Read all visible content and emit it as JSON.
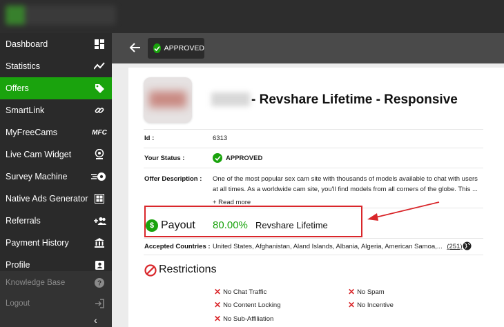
{
  "sidebar": {
    "items": [
      {
        "label": "Dashboard",
        "icon": "dashboard-icon"
      },
      {
        "label": "Statistics",
        "icon": "trend-icon"
      },
      {
        "label": "Offers",
        "icon": "tag-icon",
        "active": true
      },
      {
        "label": "SmartLink",
        "icon": "link-icon"
      },
      {
        "label": "MyFreeCams",
        "icon": "mfc-icon",
        "icon_text": "MFC"
      },
      {
        "label": "Live Cam Widget",
        "icon": "webcam-icon"
      },
      {
        "label": "Survey Machine",
        "icon": "rocket-icon"
      },
      {
        "label": "Native Ads Generator",
        "icon": "grid-icon"
      },
      {
        "label": "Referrals",
        "icon": "add-users-icon"
      },
      {
        "label": "Payment History",
        "icon": "bank-icon"
      },
      {
        "label": "Profile",
        "icon": "profile-icon"
      }
    ],
    "secondary": [
      {
        "label": "Knowledge Base",
        "icon": "help-icon"
      },
      {
        "label": "Logout",
        "icon": "logout-icon"
      }
    ],
    "collapse_icon": "chevron-left-icon"
  },
  "header": {
    "status_label": "APPROVED"
  },
  "offer": {
    "title_suffix": "- Revshare Lifetime - Responsive",
    "id_label": "Id :",
    "id_value": "6313",
    "status_label": "Your Status :",
    "status_value": "APPROVED",
    "description_label": "Offer Description :",
    "description_line1": "One of the most popular sex cam site with thousands of models available to chat with users",
    "description_line2": "at all times. As a worldwide cam site, you'll find models from all corners of the globe. This ...",
    "read_more": "+ Read more",
    "payout_label": "Payout",
    "payout_value": "80.00%",
    "payout_type": "Revshare Lifetime",
    "countries_label": "Accepted Countries :",
    "countries_value": "United States, Afghanistan, Aland Islands, Albania, Algeria, American Samoa,...",
    "countries_count": "(251)",
    "restrictions_title": "Restrictions",
    "restrictions": [
      "No Chat Traffic",
      "No Spam",
      "No Content Locking",
      "No Incentive",
      "No Sub-Affiliation"
    ]
  },
  "colors": {
    "accent": "#1aa30d",
    "annotation": "#d9262a",
    "sidebar_bg": "#2a2a2a"
  }
}
